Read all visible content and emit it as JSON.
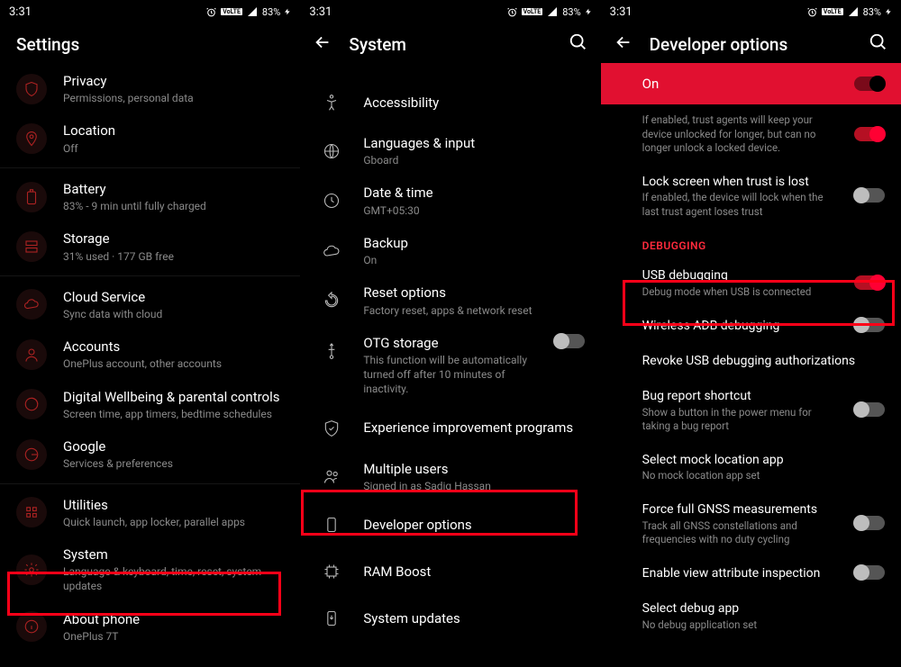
{
  "status": {
    "time": "3:31",
    "battery_text": "83%",
    "network_label": "VoLTE"
  },
  "screen1": {
    "title": "Settings",
    "items": [
      {
        "label": "Privacy",
        "sub": "Permissions, personal data"
      },
      {
        "label": "Location",
        "sub": "Off"
      },
      {
        "label": "Battery",
        "sub": "83% - 9 min until fully charged"
      },
      {
        "label": "Storage",
        "sub": "31% used · 177 GB free"
      },
      {
        "label": "Cloud Service",
        "sub": "Sync data with cloud"
      },
      {
        "label": "Accounts",
        "sub": "OnePlus account, other accounts"
      },
      {
        "label": "Digital Wellbeing & parental controls",
        "sub": "Screen time, app timers, bedtime schedules"
      },
      {
        "label": "Google",
        "sub": "Services & preferences"
      },
      {
        "label": "Utilities",
        "sub": "Quick launch, app locker, parallel apps"
      },
      {
        "label": "System",
        "sub": "Language & keyboard, time, reset, system updates"
      },
      {
        "label": "About phone",
        "sub": "OnePlus 7T"
      }
    ]
  },
  "screen2": {
    "title": "System",
    "items": [
      {
        "label": "Accessibility",
        "sub": ""
      },
      {
        "label": "Languages & input",
        "sub": "Gboard"
      },
      {
        "label": "Date & time",
        "sub": "GMT+05:30"
      },
      {
        "label": "Backup",
        "sub": "On"
      },
      {
        "label": "Reset options",
        "sub": "Factory reset, apps & network reset"
      },
      {
        "label": "OTG storage",
        "sub": "This function will be automatically turned off after 10 minutes of inactivity."
      },
      {
        "label": "Experience improvement programs",
        "sub": ""
      },
      {
        "label": "Multiple users",
        "sub": "Signed in as Sadiq Hassan"
      },
      {
        "label": "Developer options",
        "sub": ""
      },
      {
        "label": "RAM Boost",
        "sub": ""
      },
      {
        "label": "System updates",
        "sub": ""
      }
    ]
  },
  "screen3": {
    "title": "Developer options",
    "on_label": "On",
    "trust_item": {
      "sub": "If enabled, trust agents will keep your device unlocked for longer, but can no longer unlock a locked device."
    },
    "lock_item": {
      "label": "Lock screen when trust is lost",
      "sub": "If enabled, the device will lock when the last trust agent loses trust"
    },
    "debug_section": "DEBUGGING",
    "items": [
      {
        "label": "USB debugging",
        "sub": "Debug mode when USB is connected"
      },
      {
        "label": "Wireless ADB debugging",
        "sub": ""
      },
      {
        "label": "Revoke USB debugging authorizations",
        "sub": ""
      },
      {
        "label": "Bug report shortcut",
        "sub": "Show a button in the power menu for taking a bug report"
      },
      {
        "label": "Select mock location app",
        "sub": "No mock location app set"
      },
      {
        "label": "Force full GNSS measurements",
        "sub": "Track all GNSS constellations and frequencies with no duty cycling"
      },
      {
        "label": "Enable view attribute inspection",
        "sub": ""
      },
      {
        "label": "Select debug app",
        "sub": "No debug application set"
      }
    ]
  }
}
